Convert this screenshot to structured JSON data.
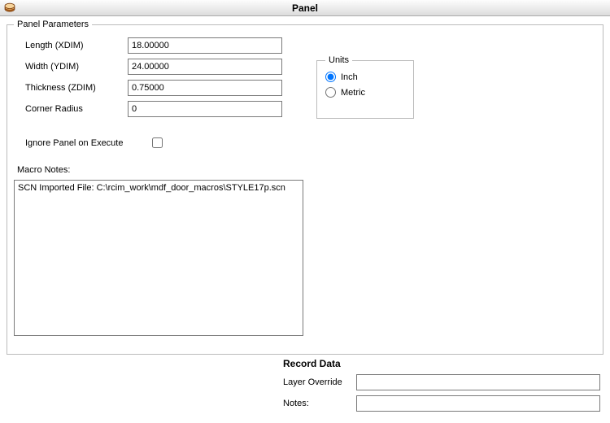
{
  "window": {
    "title": "Panel"
  },
  "panel_params": {
    "legend": "Panel Parameters",
    "length_label": "Length (XDIM)",
    "length_value": "18.00000",
    "width_label": "Width (YDIM)",
    "width_value": "24.00000",
    "thickness_label": "Thickness (ZDIM)",
    "thickness_value": "0.75000",
    "corner_radius_label": "Corner Radius",
    "corner_radius_value": "0",
    "ignore_label": "Ignore Panel on Execute",
    "ignore_checked": false,
    "macro_notes_label": "Macro Notes:",
    "macro_notes_value": "SCN Imported File: C:\\rcim_work\\mdf_door_macros\\STYLE17p.scn"
  },
  "units": {
    "legend": "Units",
    "inch_label": "Inch",
    "metric_label": "Metric",
    "selected": "inch"
  },
  "record": {
    "title": "Record Data",
    "layer_override_label": "Layer Override",
    "layer_override_value": "",
    "notes_label": "Notes:",
    "notes_value": ""
  }
}
